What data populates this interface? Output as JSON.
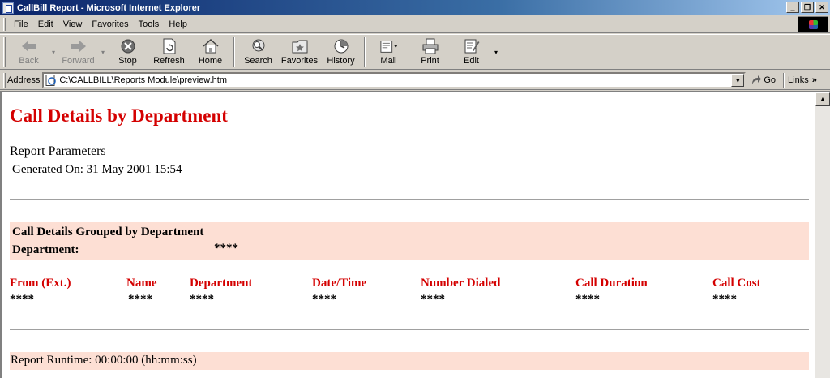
{
  "window": {
    "title": "CallBill Report - Microsoft Internet Explorer",
    "minimize": "_",
    "maximize": "❐",
    "close": "✕"
  },
  "menu": [
    {
      "label": "File",
      "accel": "F",
      "rest": "ile"
    },
    {
      "label": "Edit",
      "accel": "E",
      "rest": "dit"
    },
    {
      "label": "View",
      "accel": "V",
      "rest": "iew"
    },
    {
      "label": "Favorites",
      "accel": "F",
      "rest": "avorites",
      "accel_index": 2
    },
    {
      "label": "Tools",
      "accel": "T",
      "rest": "ools"
    },
    {
      "label": "Help",
      "accel": "H",
      "rest": "elp"
    }
  ],
  "toolbar": {
    "back": "Back",
    "forward": "Forward",
    "stop": "Stop",
    "refresh": "Refresh",
    "home": "Home",
    "search": "Search",
    "favorites": "Favorites",
    "history": "History",
    "mail": "Mail",
    "print": "Print",
    "edit": "Edit"
  },
  "address": {
    "label": "Address",
    "url": "C:\\CALLBILL\\Reports Module\\preview.htm",
    "go": "Go",
    "links": "Links"
  },
  "report": {
    "title": "Call Details by Department",
    "params_title": "Report Parameters",
    "generated": "Generated On: 31 May 2001 15:54",
    "group_title": "Call Details Grouped by Department",
    "department_label": "Department:",
    "department_value": "****",
    "columns": [
      {
        "header": "From (Ext.)",
        "value": "****"
      },
      {
        "header": "Name",
        "value": "****"
      },
      {
        "header": "Department",
        "value": "****"
      },
      {
        "header": "Date/Time",
        "value": "****"
      },
      {
        "header": "Number Dialed",
        "value": "****"
      },
      {
        "header": "Call Duration",
        "value": "****"
      },
      {
        "header": "Call Cost",
        "value": "****"
      }
    ],
    "runtime": "Report Runtime: 00:00:00 (hh:mm:ss)"
  },
  "colors": {
    "title_red": "#d40000",
    "band_peach": "#fddfd4",
    "titlebar_blue": "#0a246a"
  }
}
